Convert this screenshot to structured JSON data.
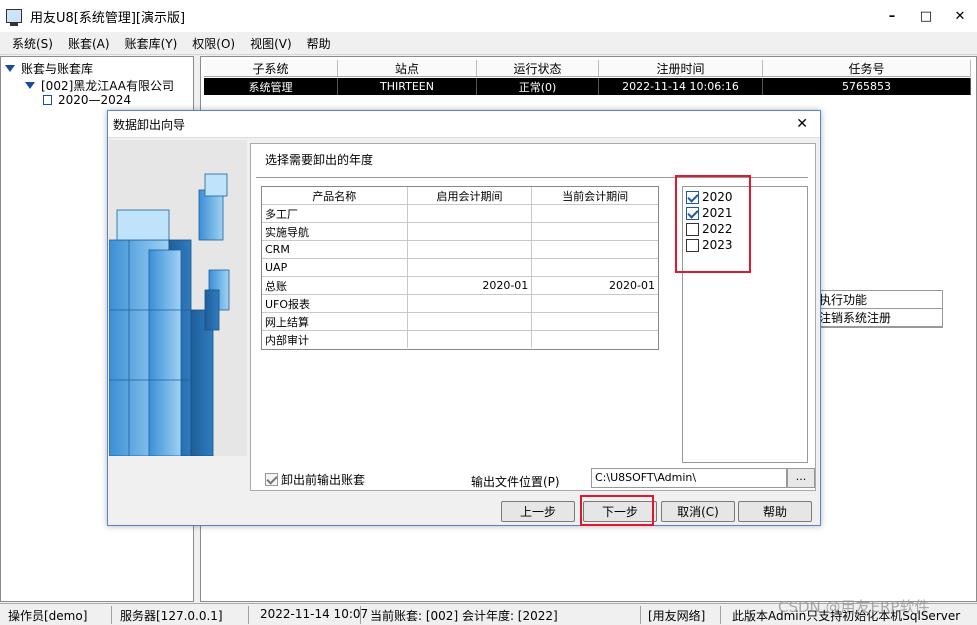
{
  "window": {
    "title": "用友U8[系统管理][演示版]",
    "min_glyph": "–",
    "max_glyph": "□",
    "close_glyph": "✕"
  },
  "menu": [
    "系统(S)",
    "账套(A)",
    "账套库(Y)",
    "权限(O)",
    "视图(V)",
    "帮助"
  ],
  "tree": {
    "root": "账套与账套库",
    "company": "[002]黑龙江AA有限公司",
    "year_range": "2020—2024"
  },
  "grid": {
    "headers": [
      "子系统",
      "站点",
      "运行状态",
      "注册时间",
      "任务号"
    ],
    "rows": [
      [
        "系统管理",
        "THIRTEEN",
        "正常(0)",
        "2022-11-14 10:06:16",
        "5765853"
      ]
    ]
  },
  "side_items": [
    "执行功能",
    "注销系统注册"
  ],
  "dialog": {
    "title": "数据卸出向导",
    "close_glyph": "✕",
    "section_title": "选择需要卸出的年度",
    "table_headers": [
      "产品名称",
      "启用会计期间",
      "当前会计期间"
    ],
    "products": [
      {
        "name": "多工厂",
        "start": "",
        "current": ""
      },
      {
        "name": "实施导航",
        "start": "",
        "current": ""
      },
      {
        "name": "CRM",
        "start": "",
        "current": ""
      },
      {
        "name": "UAP",
        "start": "",
        "current": ""
      },
      {
        "name": "总账",
        "start": "2020-01",
        "current": "2020-01"
      },
      {
        "name": "UFO报表",
        "start": "",
        "current": ""
      },
      {
        "name": "网上结算",
        "start": "",
        "current": ""
      },
      {
        "name": "内部审计",
        "start": "",
        "current": ""
      }
    ],
    "years": [
      {
        "label": "2020",
        "checked": true
      },
      {
        "label": "2021",
        "checked": true
      },
      {
        "label": "2022",
        "checked": false
      },
      {
        "label": "2023",
        "checked": false
      }
    ],
    "export_before_label": "卸出前输出账套",
    "export_before_checked": true,
    "output_label": "输出文件位置(P)",
    "output_path": "C:\\U8SOFT\\Admin\\",
    "browse_label": "...",
    "buttons": {
      "prev": "上一步",
      "next": "下一步",
      "cancel": "取消(C)",
      "help": "帮助"
    }
  },
  "status": {
    "operator": "操作员[demo]",
    "server": "服务器[127.0.0.1]",
    "datetime": "2022-11-14 10:07",
    "current_account": "当前账套: [002] 会计年度: [2022]",
    "network": "[用友网络]",
    "note": "此版本Admin只支持初始化本机SqlServer"
  },
  "watermark": "CSDN @用友ERP软件",
  "colors": {
    "highlight_box": "#e0182e",
    "dialog_border": "#5a82c8",
    "selected_row": "#000000"
  }
}
